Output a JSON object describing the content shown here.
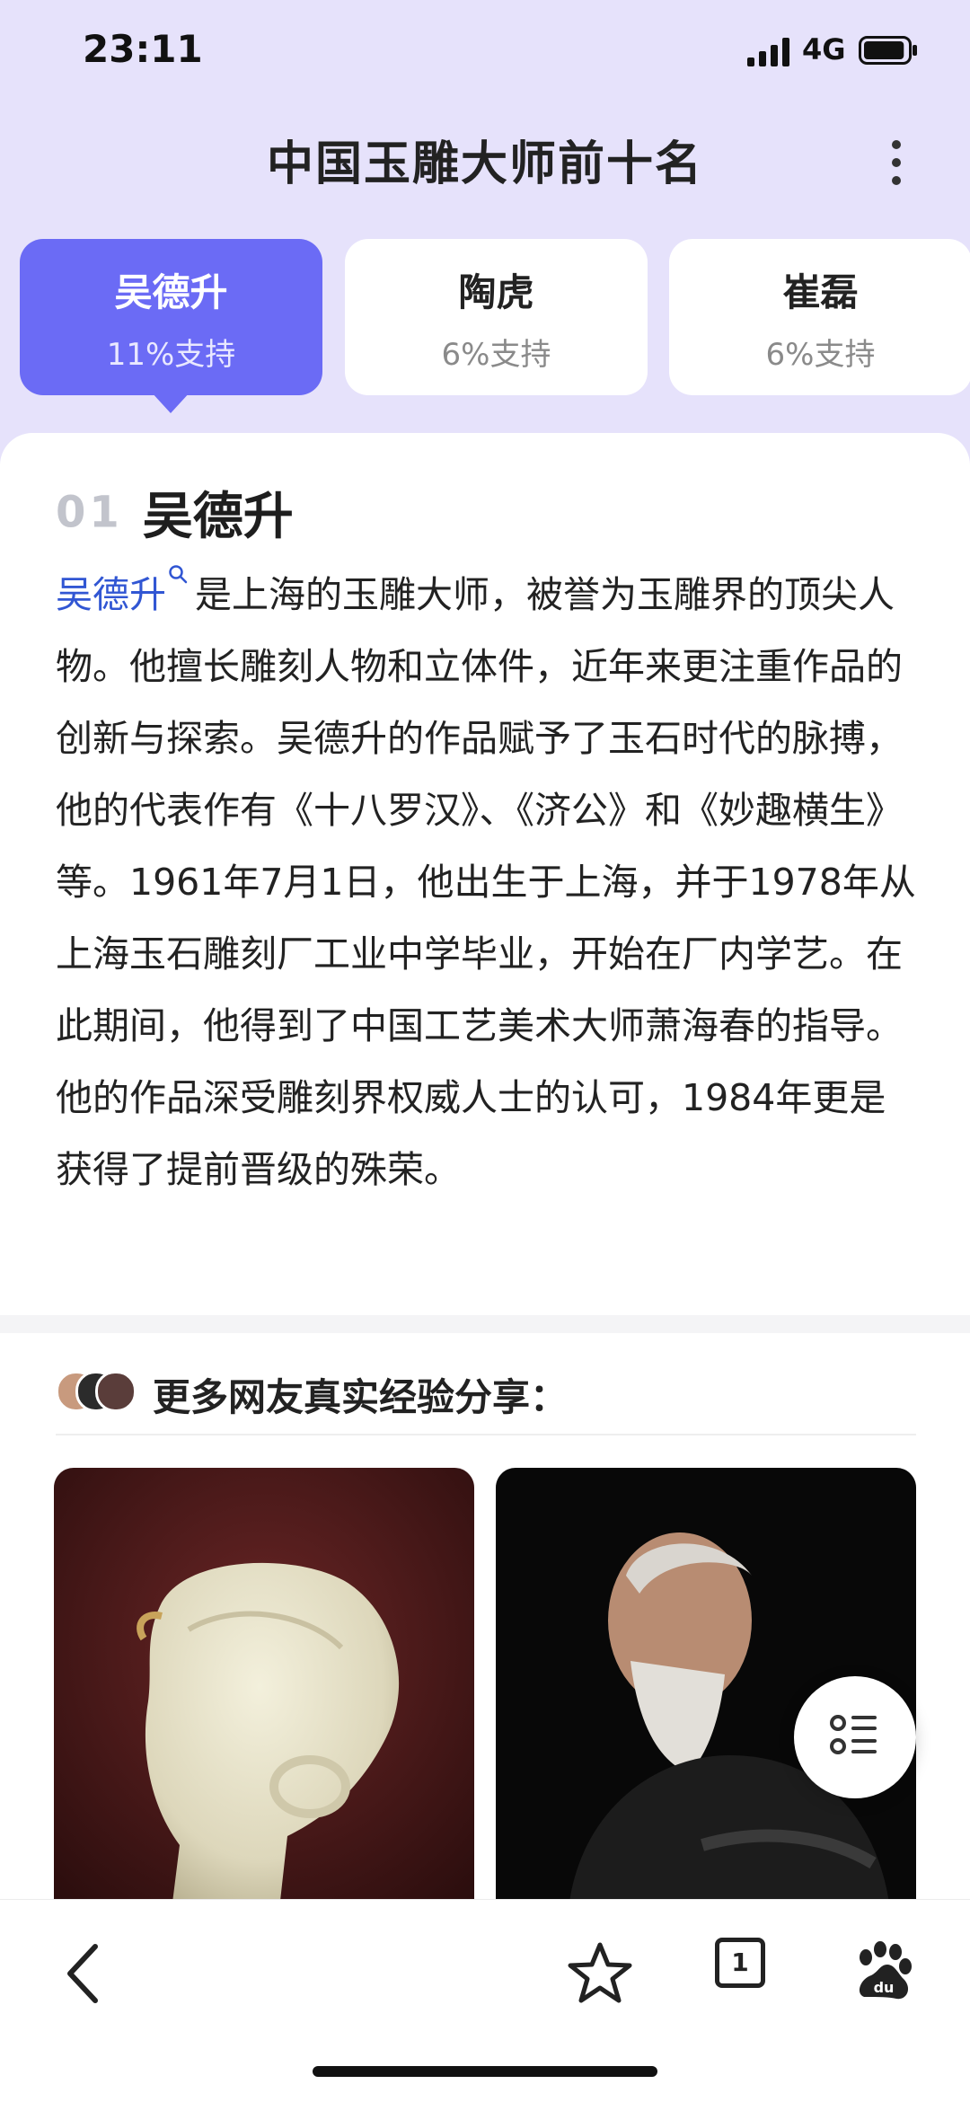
{
  "status_bar": {
    "time": "23:11",
    "network": "4G",
    "battery_level": 0.9
  },
  "header": {
    "title": "中国玉雕大师前十名",
    "more_icon": "more-vertical-icon"
  },
  "tabs": [
    {
      "name": "吴德升",
      "support": "11%支持",
      "active": true
    },
    {
      "name": "陶虎",
      "support": "6%支持",
      "active": false
    },
    {
      "name": "崔磊",
      "support": "6%支持",
      "active": false
    }
  ],
  "entry": {
    "index": "01",
    "name": "吴德升",
    "link_text": "吴德升",
    "body": "是上海的玉雕大师，被誉为玉雕界的顶尖人物。他擅长雕刻人物和立体件，近年来更注重作品的创新与探索。吴德升的作品赋予了玉石时代的脉搏，他的代表作有《十八罗汉》、《济公》和《妙趣横生》等。1961年7月1日，他出生于上海，并于1978年从上海玉石雕刻厂工业中学毕业，开始在厂内学艺。在此期间，他得到了中国工艺美术大师萧海春的指导。他的作品深受雕刻界权威人士的认可，1984年更是获得了提前晋级的殊荣。"
  },
  "share": {
    "title": "更多网友真实经验分享：",
    "photos": [
      {
        "alt": "white jade carving"
      },
      {
        "alt": "bearded artist portrait"
      }
    ]
  },
  "bottom_bar": {
    "tab_count": "1"
  },
  "colors": {
    "accent": "#6b6bf5",
    "link": "#3156d3",
    "header_bg": "#e6e2fb"
  }
}
